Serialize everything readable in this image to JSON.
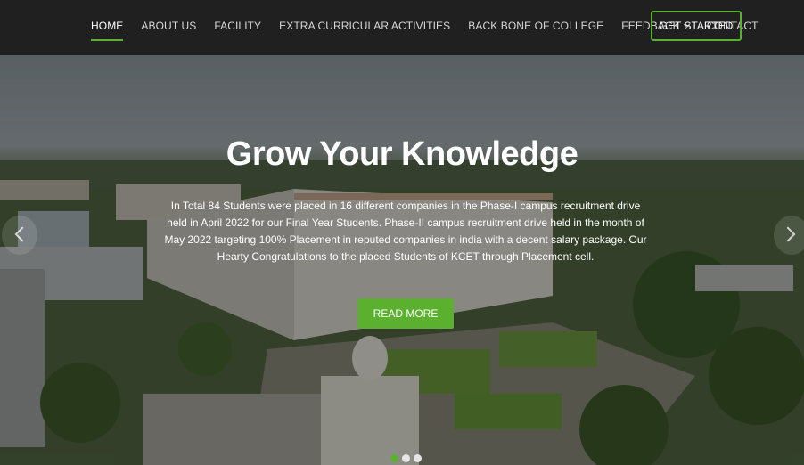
{
  "nav": {
    "items": [
      {
        "label": "HOME",
        "active": true
      },
      {
        "label": "ABOUT US"
      },
      {
        "label": "FACILITY"
      },
      {
        "label": "EXTRA CURRICULAR ACTIVITIES"
      },
      {
        "label": "BACK BONE OF COLLEGE"
      },
      {
        "label": "FEEDBACK",
        "has_dropdown": true
      },
      {
        "label": "CONTACT"
      }
    ],
    "cta_label": "GET STARTED"
  },
  "hero": {
    "title": "Grow Your Knowledge",
    "text": "In Total 84 Students were placed in 16 different companies in the Phase-I campus recruitment drive held in April 2022 for our Final Year Students. Phase-II campus recruitment drive held in the month of May 2022 targeting 100% Placement in reputed companies in india with a decent salary package. Our Hearty Congratulations to the placed Students of KCET through Placement cell.",
    "button_label": "READ MORE",
    "slide_count": 3,
    "active_slide": 1
  },
  "colors": {
    "accent": "#5bb12f",
    "navbar_bg": "#202020"
  }
}
